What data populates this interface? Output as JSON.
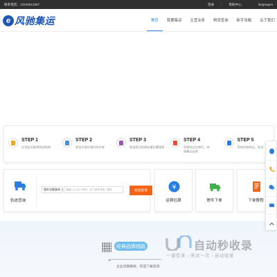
{
  "topbar": {
    "contact": "联系电话：13246613367",
    "login": "登录",
    "separator": "|",
    "help": "帮助中心",
    "languages": "languages"
  },
  "brand": {
    "logo_letter": "e",
    "name": "风驰集运"
  },
  "nav": {
    "items": [
      {
        "label": "首页",
        "active": true
      },
      {
        "label": "我要集运",
        "active": false
      },
      {
        "label": "主营业务",
        "active": false
      },
      {
        "label": "物流查询",
        "active": false
      },
      {
        "label": "新手攻略",
        "active": false
      },
      {
        "label": "关于我们",
        "active": false
      }
    ]
  },
  "steps": [
    {
      "title": "STEP 1",
      "desc": "在淘宝天猫等网站购物",
      "icon": "cart-icon",
      "color": "#f5a623"
    },
    {
      "title": "STEP 2",
      "desc": "将宝贝寄往我们的仓库",
      "icon": "warehouse-icon",
      "color": "#4a90e2"
    },
    {
      "title": "STEP 3",
      "desc": "登录我们的网站填包裹预报",
      "icon": "form-icon",
      "color": "#9b59b6"
    },
    {
      "title": "STEP 4",
      "desc": "货物到达仓库后，申请集运出库",
      "icon": "box-icon",
      "color": "#e74c3c"
    },
    {
      "title": "STEP 5",
      "desc": "等待货物到达，安全签收",
      "icon": "clipboard-icon",
      "color": "#2a7de1"
    }
  ],
  "tracking": {
    "label": "轨迹查询",
    "select_value": "国外包裹查询",
    "input_placeholder": "请输入(1-20)个单号，多个单号请用\",\"隔开",
    "button": "轨迹查询"
  },
  "cards": [
    {
      "label": "运费估算",
      "icon": "yen-icon"
    },
    {
      "label": "寄件下单",
      "icon": "truck-icon"
    },
    {
      "label": "下单教程",
      "icon": "document-icon"
    }
  ],
  "lower": {
    "pill": "经典品牌线路",
    "subtitle": "企业优质路线，欢迎了解咨询",
    "plus": "+"
  },
  "watermark": {
    "title": "自动秒收录",
    "subtitle": "一键登录→来访一次→自动收录"
  },
  "colors": {
    "accent": "#2a7de1",
    "brand": "#1e56b6",
    "button": "#f56317",
    "topbar": "#2f2f2f"
  }
}
